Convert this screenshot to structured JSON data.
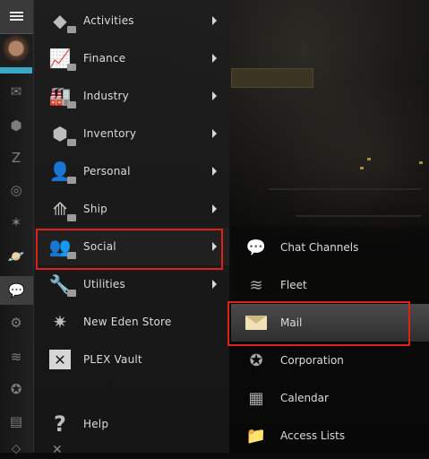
{
  "main_menu": {
    "items": [
      {
        "label": "Activities",
        "icon": "activities-icon",
        "has_submenu": true
      },
      {
        "label": "Finance",
        "icon": "finance-icon",
        "has_submenu": true
      },
      {
        "label": "Industry",
        "icon": "industry-icon",
        "has_submenu": true
      },
      {
        "label": "Inventory",
        "icon": "inventory-icon",
        "has_submenu": true
      },
      {
        "label": "Personal",
        "icon": "personal-icon",
        "has_submenu": true
      },
      {
        "label": "Ship",
        "icon": "ship-icon",
        "has_submenu": true
      },
      {
        "label": "Social",
        "icon": "social-icon",
        "has_submenu": true,
        "selected": true
      },
      {
        "label": "Utilities",
        "icon": "utilities-icon",
        "has_submenu": true
      },
      {
        "label": "New Eden Store",
        "icon": "new-eden-store-icon",
        "has_submenu": false
      },
      {
        "label": "PLEX Vault",
        "icon": "plex-vault-icon",
        "has_submenu": false
      },
      {
        "label": "Help",
        "icon": "help-icon",
        "has_submenu": false
      }
    ]
  },
  "social_submenu": {
    "items": [
      {
        "label": "Chat Channels",
        "icon": "chat-channels-icon"
      },
      {
        "label": "Fleet",
        "icon": "fleet-icon"
      },
      {
        "label": "Mail",
        "icon": "mail-icon",
        "selected": true
      },
      {
        "label": "Corporation",
        "icon": "corporation-icon"
      },
      {
        "label": "Calendar",
        "icon": "calendar-icon"
      },
      {
        "label": "Access Lists",
        "icon": "access-lists-icon"
      }
    ]
  },
  "neocom": {
    "icons": [
      "mail-icon",
      "inventory-icon",
      "z-icon",
      "skills-icon",
      "map-icon",
      "planet-icon",
      "chat-icon",
      "industry-icon",
      "fleet-icon",
      "corporation-icon",
      "wallet-icon",
      "notifications-icon"
    ]
  },
  "colors": {
    "highlight": "#e01f1f",
    "accent": "#3aa7c4"
  }
}
